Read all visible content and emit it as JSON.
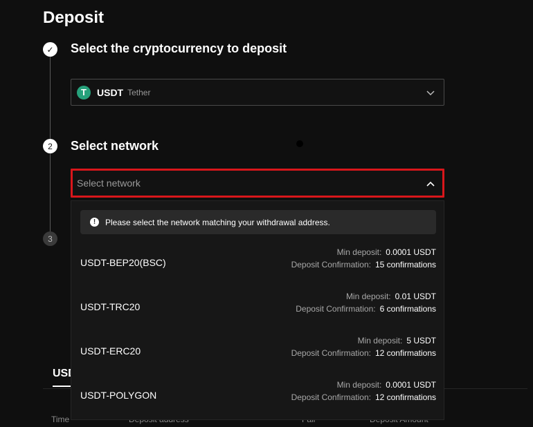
{
  "page": {
    "title": "Deposit"
  },
  "steps": [
    {
      "number": "✓",
      "title": "Select the cryptocurrency to deposit"
    },
    {
      "number": "2",
      "title": "Select network"
    },
    {
      "number": "3"
    }
  ],
  "coin_select": {
    "logo": "T",
    "symbol": "USDT",
    "name": "Tether",
    "icon": "chevron-down-icon",
    "logo_color": "#26a17b"
  },
  "network_select": {
    "placeholder": "Select network",
    "icon": "chevron-up-icon",
    "highlight_color": "#d9161b"
  },
  "dropdown": {
    "notice": "Please select the network matching your withdrawal address.",
    "notice_icon": "info-icon",
    "min_label": "Min deposit:",
    "confirm_label": "Deposit Confirmation:",
    "networks": [
      {
        "name": "USDT-BEP20(BSC)",
        "min_deposit": "0.0001 USDT",
        "confirmations": "15 confirmations"
      },
      {
        "name": "USDT-TRC20",
        "min_deposit": "0.01 USDT",
        "confirmations": "6 confirmations"
      },
      {
        "name": "USDT-ERC20",
        "min_deposit": "5 USDT",
        "confirmations": "12 confirmations"
      },
      {
        "name": "USDT-POLYGON",
        "min_deposit": "0.0001 USDT",
        "confirmations": "12 confirmations"
      }
    ]
  },
  "background": {
    "tab_label": "USD",
    "columns": [
      "Time",
      "Deposit address",
      "Fail",
      "Deposit Amount"
    ]
  }
}
